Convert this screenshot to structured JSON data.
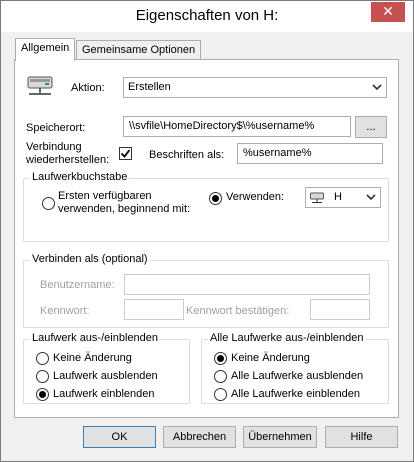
{
  "window": {
    "title": "Eigenschaften von H:",
    "close_glyph": "✕"
  },
  "tabs": [
    {
      "label": "Allgemein",
      "active": true
    },
    {
      "label": "Gemeinsame Optionen",
      "active": false
    }
  ],
  "action": {
    "label": "Aktion:",
    "value": "Erstellen",
    "icon": "network-drive-icon"
  },
  "location": {
    "label": "Speicherort:",
    "value": "\\\\svfile\\HomeDirectory$\\%username%",
    "browse_label": "..."
  },
  "reconnect": {
    "label_line1": "Verbindung",
    "label_line2": "wiederherstellen:",
    "checked": true
  },
  "label_as": {
    "label": "Beschriften als:",
    "value": "%username%"
  },
  "drive_letter": {
    "group_label": "Laufwerkbuchstabe",
    "option_first_line1": "Ersten verfügbaren",
    "option_first_line2": "verwenden, beginnend mit:",
    "option_use": "Verwenden:",
    "use_selected": true,
    "letter": "H"
  },
  "connect_as": {
    "group_label": "Verbinden als (optional)",
    "username_label": "Benutzername:",
    "password_label": "Kennwort:",
    "confirm_label": "Kennwort bestätigen:"
  },
  "drive_visibility": {
    "group_label": "Laufwerk aus-/einblenden",
    "options": [
      "Keine Änderung",
      "Laufwerk ausblenden",
      "Laufwerk einblenden"
    ],
    "selected": 2
  },
  "all_drives_visibility": {
    "group_label": "Alle Laufwerke aus-/einblenden",
    "options": [
      "Keine Änderung",
      "Alle Laufwerke ausblenden",
      "Alle Laufwerke einblenden"
    ],
    "selected": 0
  },
  "buttons": {
    "ok": "OK",
    "cancel": "Abbrechen",
    "apply": "Übernehmen",
    "help": "Hilfe"
  },
  "colors": {
    "close_button": "#c75050",
    "default_button_border": "#3c7fb1"
  }
}
